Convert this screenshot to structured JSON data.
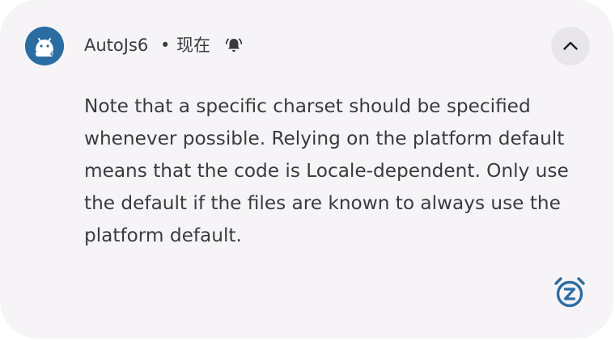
{
  "notification": {
    "app_name": "AutoJs6",
    "separator": "•",
    "time": "现在",
    "message": "Note that a specific charset should be specified whenever possible. Relying on the platform default means that the code is Locale-dependent. Only use the default if the files are known to always use the platform default.",
    "icons": {
      "app": "autojs6-app-icon",
      "bell": "bell-alert-icon",
      "expand": "chevron-up-icon",
      "snooze": "snooze-alarm-icon"
    },
    "colors": {
      "background": "#f6f4f7",
      "accent": "#2b6da3",
      "text": "#3b3b3e"
    }
  }
}
